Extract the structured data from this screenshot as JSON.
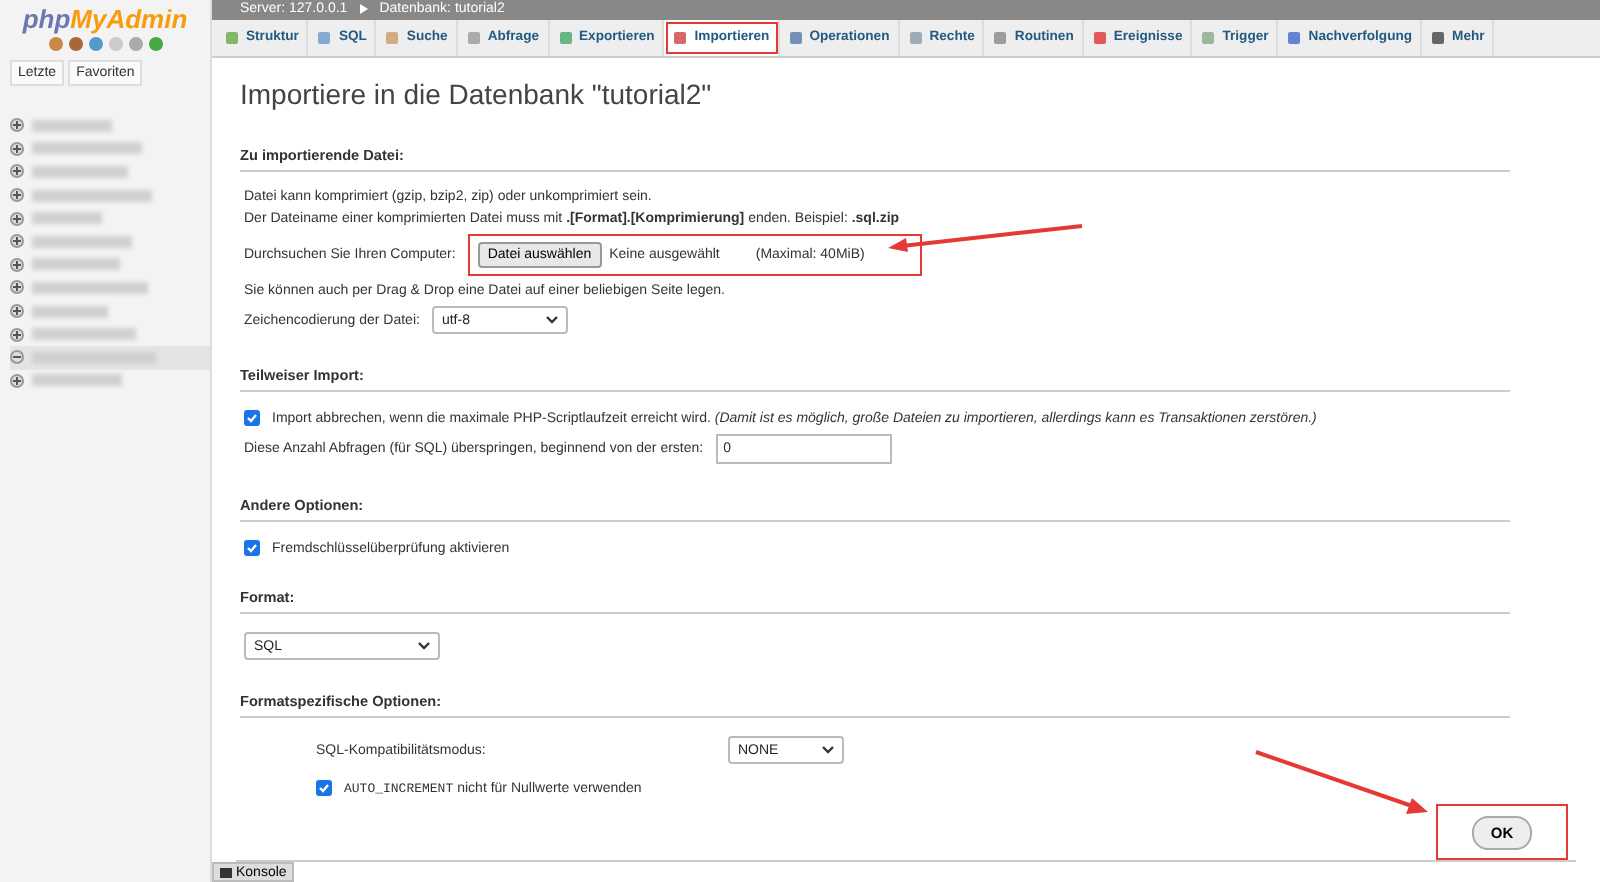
{
  "logo": {
    "part1": "php",
    "part2": "MyAdmin"
  },
  "sidebar": {
    "tabs": [
      "Letzte",
      "Favoriten"
    ],
    "tree_items": [
      {
        "expanded": false,
        "selected": false
      },
      {
        "expanded": false,
        "selected": false
      },
      {
        "expanded": false,
        "selected": false
      },
      {
        "expanded": false,
        "selected": false
      },
      {
        "expanded": false,
        "selected": false
      },
      {
        "expanded": false,
        "selected": false
      },
      {
        "expanded": false,
        "selected": false
      },
      {
        "expanded": false,
        "selected": false
      },
      {
        "expanded": false,
        "selected": false
      },
      {
        "expanded": false,
        "selected": false
      },
      {
        "expanded": true,
        "selected": true
      },
      {
        "expanded": false,
        "selected": false
      }
    ]
  },
  "breadcrumb": [
    "Server: 127.0.0.1",
    "Datenbank: tutorial2"
  ],
  "tabs": [
    {
      "label": "Struktur",
      "selected": false
    },
    {
      "label": "SQL",
      "selected": false
    },
    {
      "label": "Suche",
      "selected": false
    },
    {
      "label": "Abfrage",
      "selected": false
    },
    {
      "label": "Exportieren",
      "selected": false
    },
    {
      "label": "Importieren",
      "selected": true
    },
    {
      "label": "Operationen",
      "selected": false
    },
    {
      "label": "Rechte",
      "selected": false
    },
    {
      "label": "Routinen",
      "selected": false
    },
    {
      "label": "Ereignisse",
      "selected": false
    },
    {
      "label": "Trigger",
      "selected": false
    },
    {
      "label": "Nachverfolgung",
      "selected": false
    },
    {
      "label": "Mehr",
      "selected": false
    }
  ],
  "title": "Importiere in die Datenbank \"tutorial2\"",
  "file_section": {
    "heading": "Zu importierende Datei:",
    "line1": "Datei kann komprimiert (gzip, bzip2, zip) oder unkomprimiert sein.",
    "line2": "Der Dateiname einer komprimierten Datei muss mit **.[Format].[Komprimierung]** enden. Beispiel: **.sql.zip**",
    "browse_label": "Durchsuchen Sie Ihren Computer:",
    "browse_button": "Datei auswählen",
    "no_file": "Keine ausgewählt",
    "max_size": "(Maximal: 40MiB)",
    "drag_hint": "Sie können auch per Drag & Drop eine Datei auf einer beliebigen Seite legen.",
    "encoding_label": "Zeichencodierung der Datei:",
    "encoding_value": "utf-8"
  },
  "partial_section": {
    "heading": "Teilweiser Import:",
    "abort_checked": true,
    "abort_label": "Import abbrechen, wenn die maximale PHP-Scriptlaufzeit erreicht wird. *(Damit ist es möglich, große Dateien zu importieren, allerdings kann es Transaktionen zerstören.)*",
    "skip_label": "Diese Anzahl Abfragen (für SQL) überspringen, beginnend von der ersten:",
    "skip_value": "0"
  },
  "other_section": {
    "heading": "Andere Optionen:",
    "fk_checked": true,
    "fk_label": "Fremdschlüsselüberprüfung aktivieren"
  },
  "format_section": {
    "heading": "Format:",
    "format_value": "SQL"
  },
  "format_options": {
    "heading": "Formatspezifische Optionen:",
    "compat_label": "SQL-Kompatibilitätsmodus:",
    "compat_value": "NONE",
    "autoinc_checked": true,
    "autoinc_code": "AUTO_INCREMENT",
    "autoinc_label": "nicht für Nullwerte verwenden"
  },
  "ok_button": "OK",
  "console_button": "Konsole"
}
